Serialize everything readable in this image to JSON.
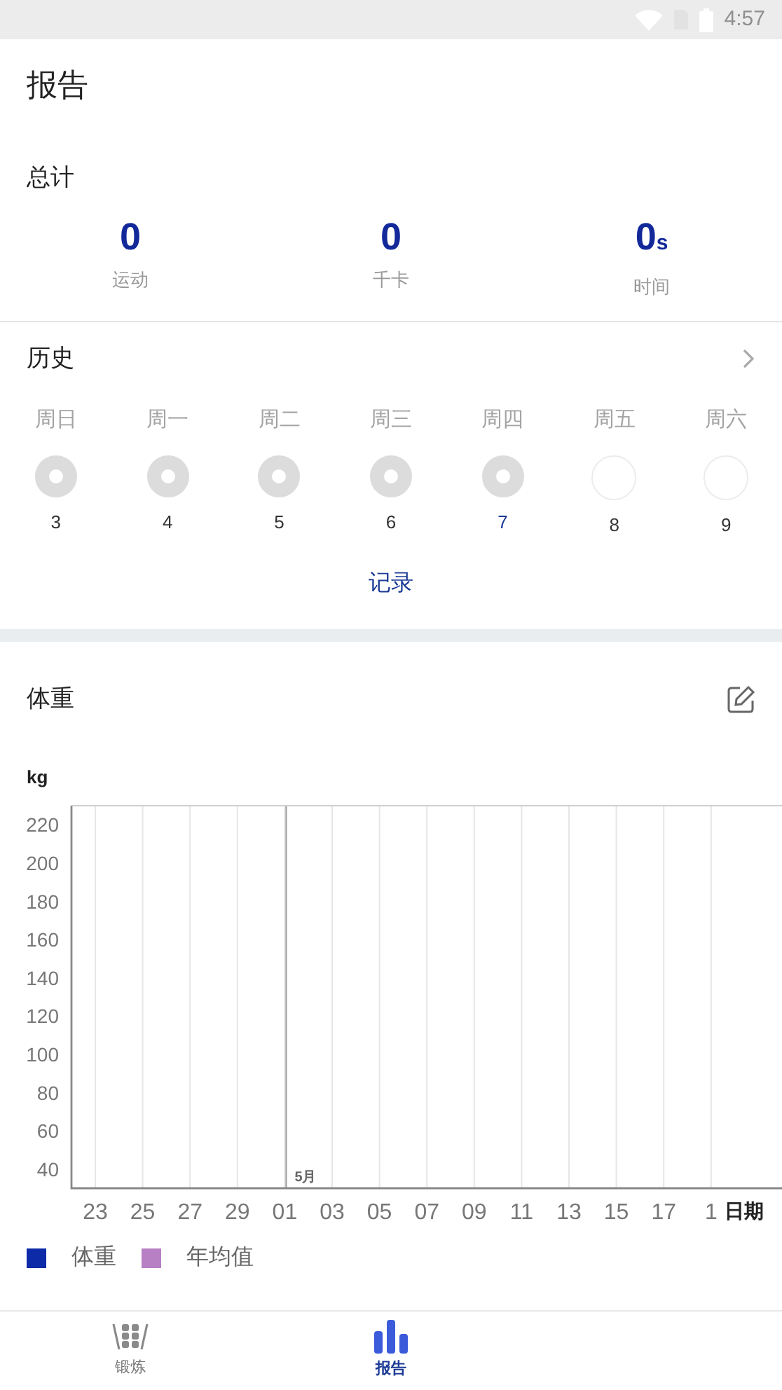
{
  "status_bar": {
    "time": "4:57"
  },
  "header": {
    "title": "报告"
  },
  "totals": {
    "title": "总计",
    "stats": [
      {
        "value": "0",
        "label": "运动"
      },
      {
        "value": "0",
        "label": "千卡"
      },
      {
        "value": "0",
        "unit": "s",
        "label": "时间"
      }
    ]
  },
  "history": {
    "title": "历史",
    "days": [
      {
        "weekday": "周日",
        "date": "3",
        "done": true,
        "today": false
      },
      {
        "weekday": "周一",
        "date": "4",
        "done": true,
        "today": false
      },
      {
        "weekday": "周二",
        "date": "5",
        "done": true,
        "today": false
      },
      {
        "weekday": "周三",
        "date": "6",
        "done": true,
        "today": false
      },
      {
        "weekday": "周四",
        "date": "7",
        "done": true,
        "today": true
      },
      {
        "weekday": "周五",
        "date": "8",
        "done": false,
        "today": false
      },
      {
        "weekday": "周六",
        "date": "9",
        "done": false,
        "today": false
      }
    ],
    "link": "记录"
  },
  "weight": {
    "title": "体重",
    "unit": "kg",
    "chart_data": {
      "type": "line",
      "xlabel": "日期",
      "categories": [
        "23",
        "25",
        "27",
        "29",
        "01",
        "03",
        "05",
        "07",
        "09",
        "11",
        "13",
        "15",
        "17",
        "1"
      ],
      "ylim": [
        30,
        230
      ],
      "grid": true,
      "yticks": [
        40,
        60,
        80,
        100,
        120,
        140,
        160,
        180,
        200,
        220
      ],
      "series": [
        {
          "name": "体重",
          "color": "#0d2aa8",
          "values": [
            null,
            null,
            null,
            null,
            null,
            null,
            null,
            null,
            null,
            null,
            null,
            null,
            null,
            null
          ]
        },
        {
          "name": "年均值",
          "color": "#b77fc4",
          "values": [
            null,
            null,
            null,
            null,
            null,
            null,
            null,
            null,
            null,
            null,
            null,
            null,
            null,
            null
          ]
        }
      ],
      "ref_lines": [
        {
          "axis": "x",
          "value": "01",
          "label": "5月"
        }
      ]
    }
  },
  "bottom_nav": [
    {
      "label": "锻炼",
      "selected": false
    },
    {
      "label": "报告",
      "selected": true
    }
  ]
}
